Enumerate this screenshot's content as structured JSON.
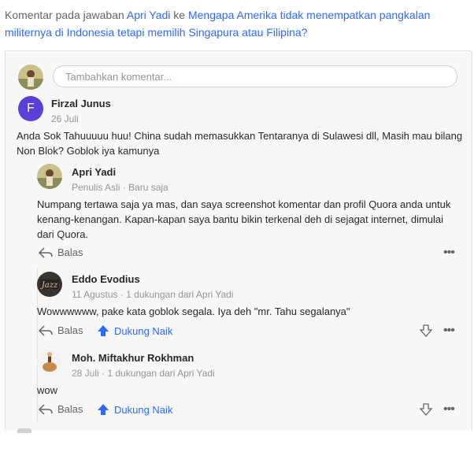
{
  "header": {
    "prefix": "Komentar pada jawaban ",
    "author": "Apri Yadi",
    "mid": " ke ",
    "question": "Mengapa Amerika tidak menempatkan pangkalan militernya di Indonesia tetapi memilih Singapura atau Filipina?"
  },
  "compose": {
    "placeholder": "Tambahkan komentar..."
  },
  "comments": [
    {
      "initial": "F",
      "name": "Firzal Junus",
      "meta": "26 Juli",
      "text": "Anda Sok Tahuuuuu huu! China sudah memasukkan Tentaranya di Sulawesi dll, Masih mau bilang Non Blok? Goblok iya kamunya",
      "avatar_color": "#5b3fd8"
    },
    {
      "name": "Apri Yadi",
      "meta": "Penulis Asli · Baru saja",
      "text": "Numpang tertawa saja ya mas, dan saya screenshot komentar dan profil Quora anda untuk kenang-kenangan. Kapan-kapan saya bantu bikin terkenal deh di sejagat internet, dimulai dari Quora.",
      "reply_label": "Balas"
    },
    {
      "name": "Eddo Evodius",
      "meta": "11 Agustus · 1 dukungan dari Apri Yadi",
      "text": "Wowwwwww, pake kata goblok segala. Iya deh \"mr. Tahu segalanya\"",
      "reply_label": "Balas",
      "upvote_label": "Dukung Naik"
    },
    {
      "name": "Moh. Miftakhur Rokhman",
      "meta": "28 Juli · 1 dukungan dari Apri Yadi",
      "text": "wow",
      "reply_label": "Balas",
      "upvote_label": "Dukung Naik"
    }
  ],
  "icons": {
    "reply": "reply-arrow-icon",
    "upvote": "upvote-arrow-icon",
    "downvote": "downvote-arrow-icon",
    "more": "more-dots-icon"
  },
  "colors": {
    "link": "#2e69ff",
    "upvote": "#2e69ff",
    "panel_bg": "#f7f7f8"
  }
}
